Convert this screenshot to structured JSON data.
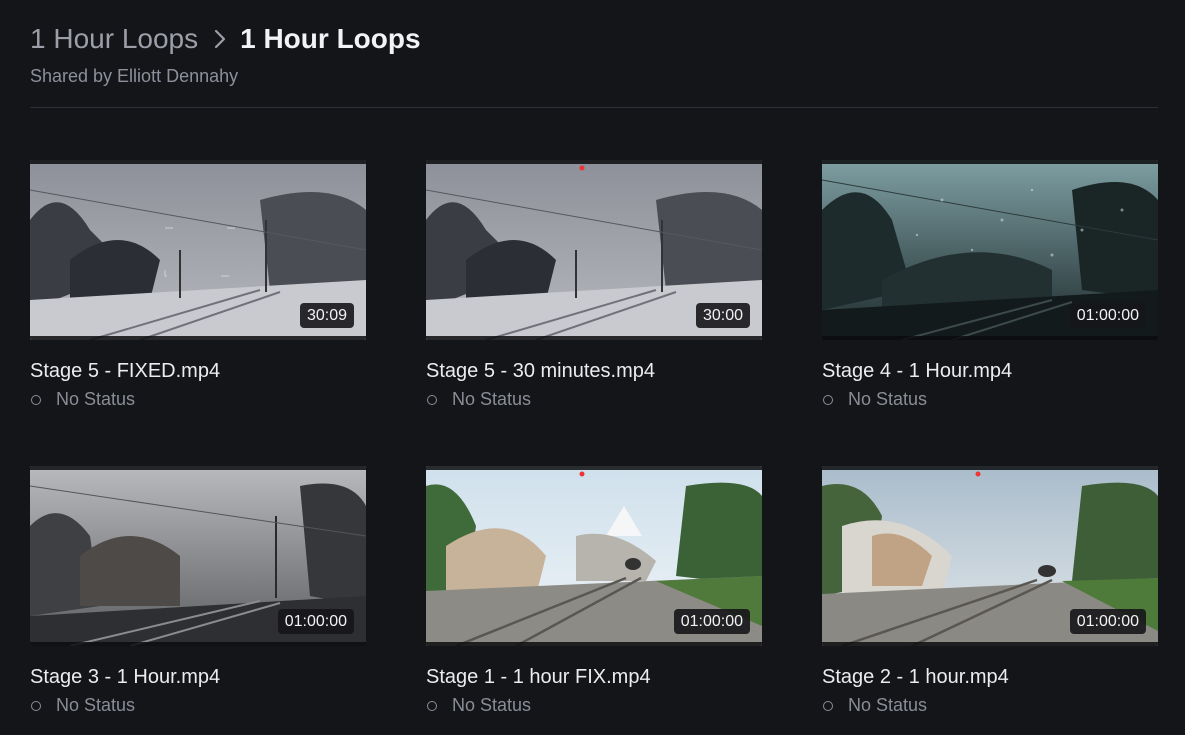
{
  "breadcrumb": {
    "parent": "1 Hour Loops",
    "current": "1 Hour Loops"
  },
  "shared_by": "Shared by Elliott Dennahy",
  "icons": {
    "separator": "chevron-right-icon",
    "status": "status-circle-icon"
  },
  "colors": {
    "background": "#141519",
    "text_primary": "#ececf0",
    "text_muted": "#8a8d96"
  },
  "items": [
    {
      "title": "Stage 5 - FIXED.mp4",
      "duration": "30:09",
      "status": "No Status",
      "scene": "snow-night"
    },
    {
      "title": "Stage 5 - 30 minutes.mp4",
      "duration": "30:00",
      "status": "No Status",
      "scene": "snow-night"
    },
    {
      "title": "Stage 4 - 1 Hour.mp4",
      "duration": "01:00:00",
      "status": "No Status",
      "scene": "rain-teal"
    },
    {
      "title": "Stage 3 - 1 Hour.mp4",
      "duration": "01:00:00",
      "status": "No Status",
      "scene": "rain-grey"
    },
    {
      "title": "Stage 1 - 1 hour FIX.mp4",
      "duration": "01:00:00",
      "status": "No Status",
      "scene": "sunny"
    },
    {
      "title": "Stage 2 - 1 hour.mp4",
      "duration": "01:00:00",
      "status": "No Status",
      "scene": "sunny-cloud"
    }
  ]
}
